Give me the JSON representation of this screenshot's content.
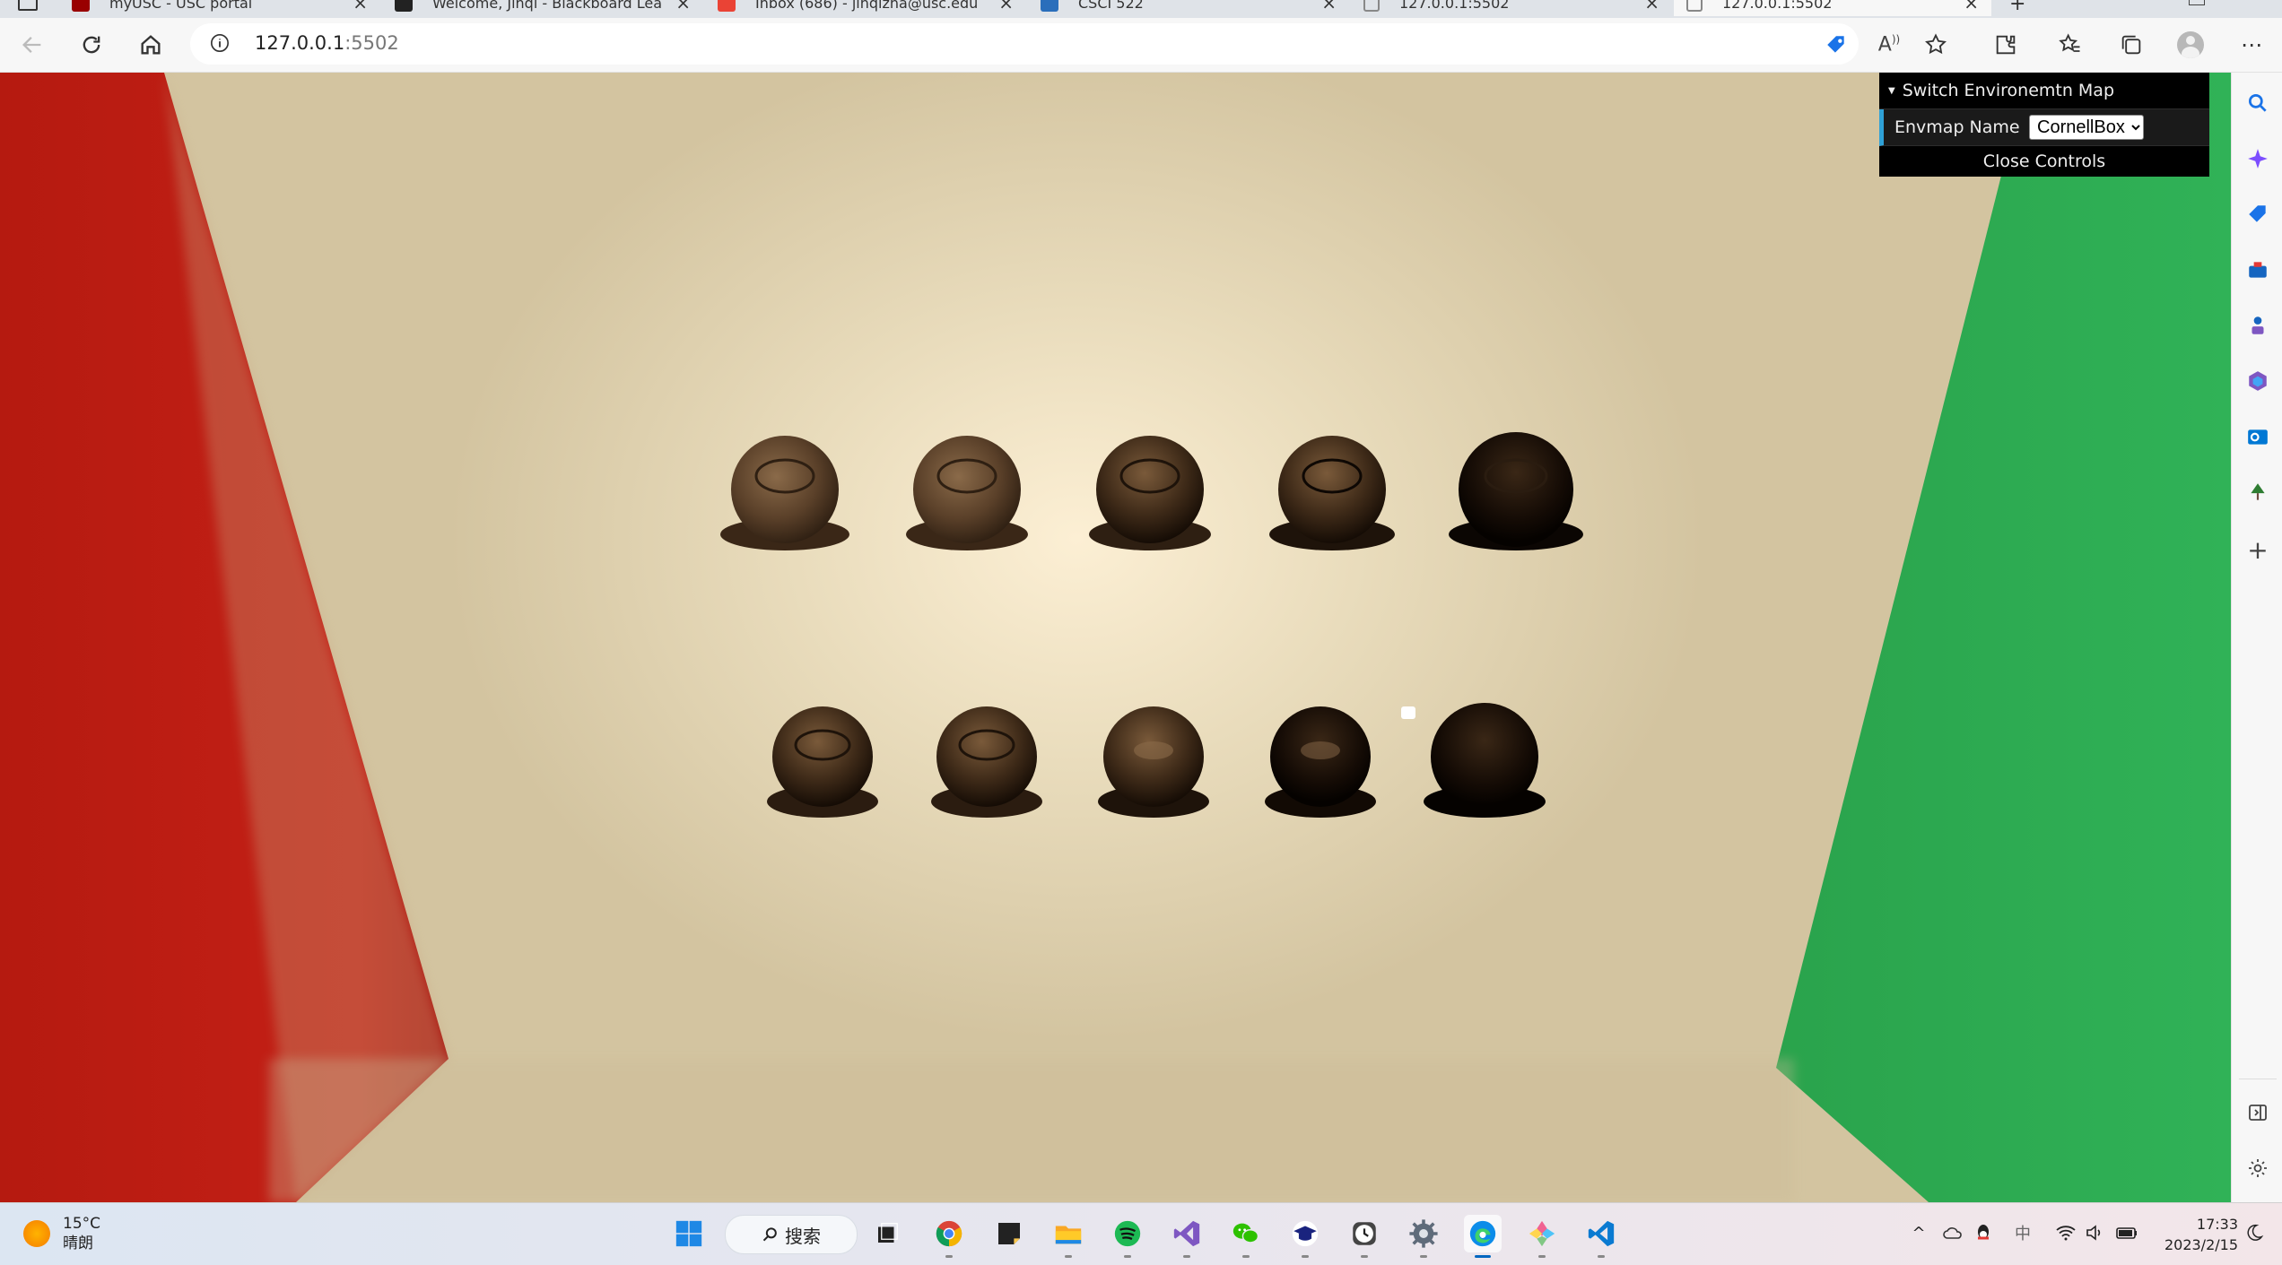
{
  "tabs": [
    {
      "label": "myUSC - USC portal",
      "favicon_color": "#990000"
    },
    {
      "label": "Welcome, Jinqi - Blackboard Lea",
      "favicon_color": "#222222"
    },
    {
      "label": "Inbox (686) - jinqizha@usc.edu",
      "favicon_color": "#ea4335"
    },
    {
      "label": "CSCI 522",
      "favicon_color": "#2a6ebb"
    },
    {
      "label": "127.0.0.1:5502",
      "favicon_color": "#888888"
    },
    {
      "label": "127.0.0.1:5502",
      "favicon_color": "#888888"
    }
  ],
  "address": {
    "host": "127.0.0.1",
    "port": ":5502"
  },
  "gui": {
    "folder_title": "Switch Environemtn Map",
    "envmap_label": "Envmap Name",
    "envmap_value": "CornellBox",
    "close_label": "Close Controls"
  },
  "scene": {
    "left_wall_color": "#b81c12",
    "right_wall_color": "#2aa84e",
    "top_row_balls": 5,
    "bottom_row_balls": 5
  },
  "sidebar_icons": [
    "search-icon",
    "copilot-icon",
    "shopping-icon",
    "tools-icon",
    "games-icon",
    "office-icon",
    "outlook-icon",
    "tree-icon",
    "add-icon",
    "split-screen-icon",
    "settings-icon"
  ],
  "taskbar": {
    "weather_temp": "15°C",
    "weather_desc": "晴朗",
    "search_label": "搜索",
    "time": "17:33",
    "date": "2023/2/15",
    "ime": "中",
    "apps": [
      "windows-start",
      "task-view",
      "chrome",
      "sticky-notes",
      "file-explorer",
      "spotify",
      "visual-studio",
      "wechat",
      "usc-app",
      "clock",
      "settings",
      "edge",
      "paint",
      "vscode"
    ]
  }
}
